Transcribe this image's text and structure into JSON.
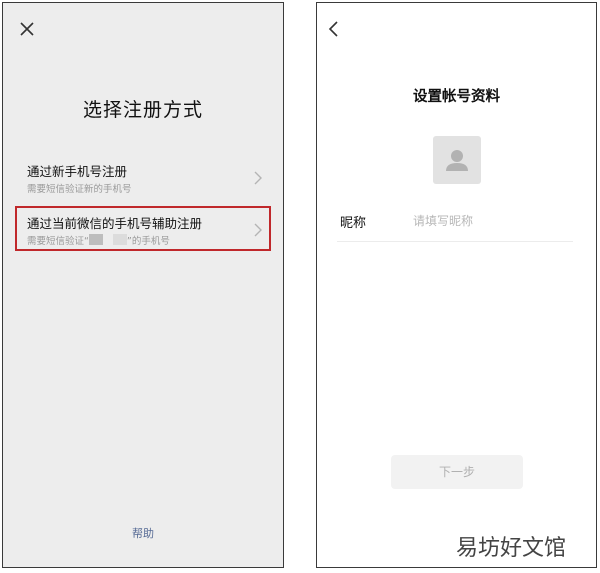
{
  "left_screen": {
    "title": "选择注册方式",
    "options": [
      {
        "title": "通过新手机号注册",
        "subtitle": "需要短信验证新的手机号"
      },
      {
        "title": "通过当前微信的手机号辅助注册",
        "subtitle_prefix": "需要短信验证“",
        "subtitle_suffix": "”的手机号"
      }
    ],
    "help_label": "帮助",
    "highlight_color": "#c0282b"
  },
  "right_screen": {
    "title": "设置帐号资料",
    "nickname_label": "昵称",
    "nickname_placeholder": "请填写昵称",
    "nickname_value": "",
    "next_label": "下一步"
  },
  "watermark": "易坊好文馆",
  "icons": [
    "close-icon",
    "chevron-right-icon",
    "back-arrow-icon",
    "avatar-placeholder-icon"
  ]
}
